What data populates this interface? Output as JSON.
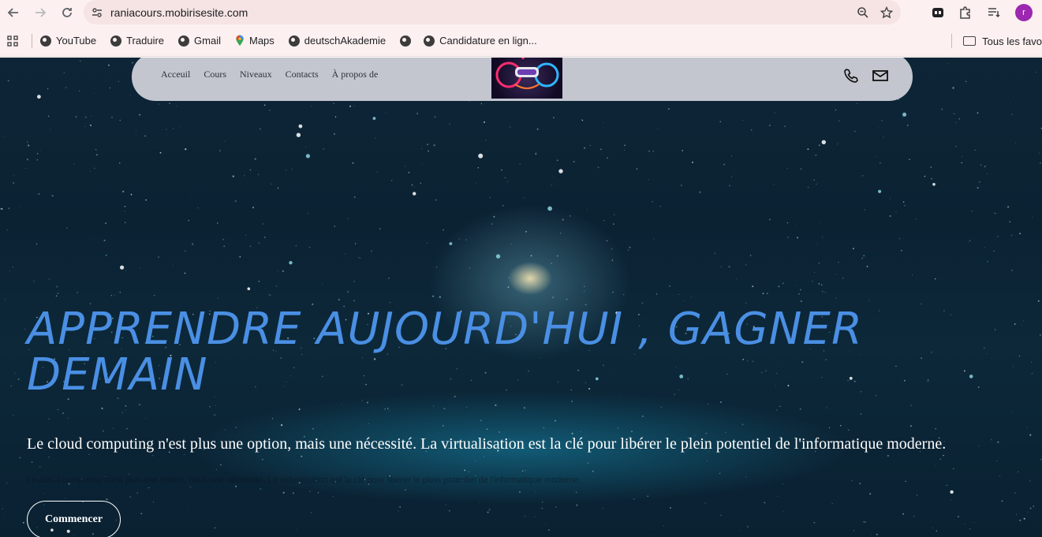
{
  "browser": {
    "url": "raniacours.mobirisesite.com",
    "profile_initial": "r",
    "bookmarks": [
      {
        "label": "YouTube",
        "icon": "globe-icon"
      },
      {
        "label": "Traduire",
        "icon": "globe-icon"
      },
      {
        "label": "Gmail",
        "icon": "globe-icon"
      },
      {
        "label": "Maps",
        "icon": "maps-pin-icon"
      },
      {
        "label": "deutschAkademie",
        "icon": "globe-icon"
      },
      {
        "label": "",
        "icon": "globe-icon"
      },
      {
        "label": "Candidature en lign...",
        "icon": "globe-icon"
      }
    ],
    "all_bookmarks_label": "Tous les favo"
  },
  "site": {
    "nav": [
      "Acceuil",
      "Cours",
      "Niveaux",
      "Contacts",
      "À propos de"
    ],
    "hero": {
      "title": "APPRENDRE AUJOURD'HUI , GAGNER DEMAIN",
      "subtitle": "Le cloud computing n'est plus une option, mais une nécessité. La virtualisation est la clé pour libérer le plein potentiel de l'informatique moderne.",
      "faint_text": "Le cloud computing n'est plus une option, mais une nécessité. La virtualisation est la clé pour libérer le plein potentiel de l'informatique moderne.",
      "cta_label": "Commencer"
    }
  },
  "colors": {
    "title_blue": "#4a8fe4",
    "navbar_bg": "#c3c6cf",
    "page_bg": "#0c2839",
    "chrome_bg": "#fdf0f0",
    "profile": "#9c27b0"
  }
}
